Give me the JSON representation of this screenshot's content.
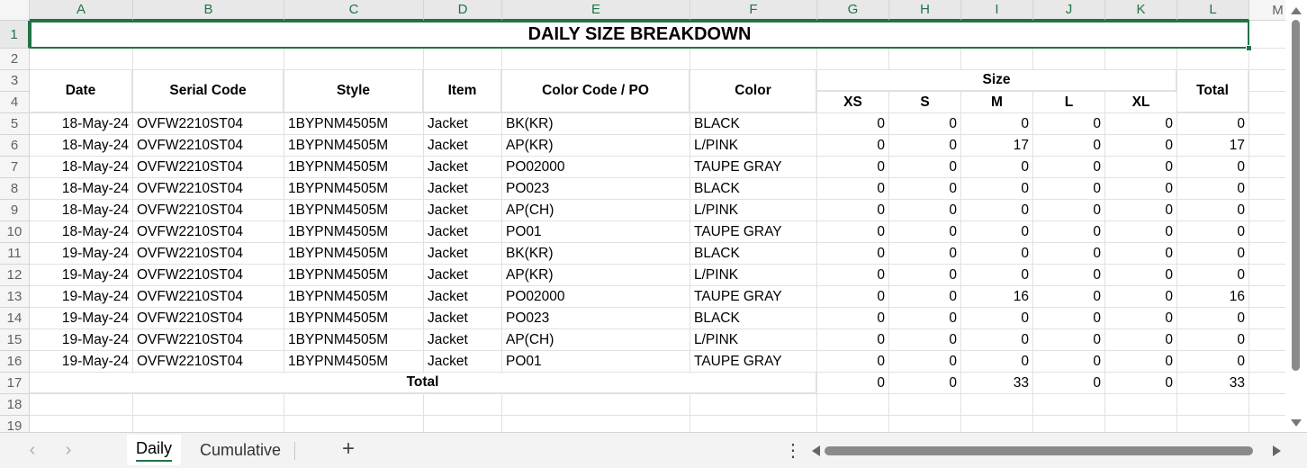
{
  "columns": [
    "A",
    "B",
    "C",
    "D",
    "E",
    "F",
    "G",
    "H",
    "I",
    "J",
    "K",
    "L",
    "M"
  ],
  "rows": [
    "1",
    "2",
    "3",
    "4",
    "5",
    "6",
    "7",
    "8",
    "9",
    "10",
    "11",
    "12",
    "13",
    "14",
    "15",
    "16",
    "17",
    "18",
    "19"
  ],
  "title": "DAILY SIZE BREAKDOWN",
  "headers": {
    "date": "Date",
    "serial": "Serial Code",
    "style": "Style",
    "item": "Item",
    "color_code": "Color Code / PO",
    "color": "Color",
    "size": "Size",
    "total": "Total",
    "sizes": [
      "XS",
      "S",
      "M",
      "L",
      "XL"
    ]
  },
  "data_rows": [
    [
      "18-May-24",
      "OVFW2210ST04",
      "1BYPNM4505M",
      "Jacket",
      "BK(KR)",
      "BLACK",
      "0",
      "0",
      "0",
      "0",
      "0",
      "0"
    ],
    [
      "18-May-24",
      "OVFW2210ST04",
      "1BYPNM4505M",
      "Jacket",
      "AP(KR)",
      "L/PINK",
      "0",
      "0",
      "17",
      "0",
      "0",
      "17"
    ],
    [
      "18-May-24",
      "OVFW2210ST04",
      "1BYPNM4505M",
      "Jacket",
      "PO02000",
      "TAUPE GRAY",
      "0",
      "0",
      "0",
      "0",
      "0",
      "0"
    ],
    [
      "18-May-24",
      "OVFW2210ST04",
      "1BYPNM4505M",
      "Jacket",
      "PO023",
      "BLACK",
      "0",
      "0",
      "0",
      "0",
      "0",
      "0"
    ],
    [
      "18-May-24",
      "OVFW2210ST04",
      "1BYPNM4505M",
      "Jacket",
      "AP(CH)",
      "L/PINK",
      "0",
      "0",
      "0",
      "0",
      "0",
      "0"
    ],
    [
      "18-May-24",
      "OVFW2210ST04",
      "1BYPNM4505M",
      "Jacket",
      "PO01",
      "TAUPE GRAY",
      "0",
      "0",
      "0",
      "0",
      "0",
      "0"
    ],
    [
      "19-May-24",
      "OVFW2210ST04",
      "1BYPNM4505M",
      "Jacket",
      "BK(KR)",
      "BLACK",
      "0",
      "0",
      "0",
      "0",
      "0",
      "0"
    ],
    [
      "19-May-24",
      "OVFW2210ST04",
      "1BYPNM4505M",
      "Jacket",
      "AP(KR)",
      "L/PINK",
      "0",
      "0",
      "0",
      "0",
      "0",
      "0"
    ],
    [
      "19-May-24",
      "OVFW2210ST04",
      "1BYPNM4505M",
      "Jacket",
      "PO02000",
      "TAUPE GRAY",
      "0",
      "0",
      "16",
      "0",
      "0",
      "16"
    ],
    [
      "19-May-24",
      "OVFW2210ST04",
      "1BYPNM4505M",
      "Jacket",
      "PO023",
      "BLACK",
      "0",
      "0",
      "0",
      "0",
      "0",
      "0"
    ],
    [
      "19-May-24",
      "OVFW2210ST04",
      "1BYPNM4505M",
      "Jacket",
      "AP(CH)",
      "L/PINK",
      "0",
      "0",
      "0",
      "0",
      "0",
      "0"
    ],
    [
      "19-May-24",
      "OVFW2210ST04",
      "1BYPNM4505M",
      "Jacket",
      "PO01",
      "TAUPE GRAY",
      "0",
      "0",
      "0",
      "0",
      "0",
      "0"
    ]
  ],
  "total_row": {
    "label": "Total",
    "values": [
      "0",
      "0",
      "33",
      "0",
      "0",
      "33"
    ]
  },
  "tabs": [
    {
      "label": "Daily",
      "active": true
    },
    {
      "label": "Cumulative",
      "active": false
    }
  ],
  "tab_bar": {
    "prev_label": "‹",
    "next_label": "›",
    "add_label": "+",
    "more_label": "⋮"
  },
  "icons": {
    "prev_sheet": "chevron-left-icon",
    "next_sheet": "chevron-right-icon",
    "add_sheet": "plus-icon",
    "more": "more-vertical-icon"
  },
  "colors": {
    "accent": "#217346",
    "header_bg": "#f5f5f5",
    "gridline": "#e1e1e1"
  }
}
